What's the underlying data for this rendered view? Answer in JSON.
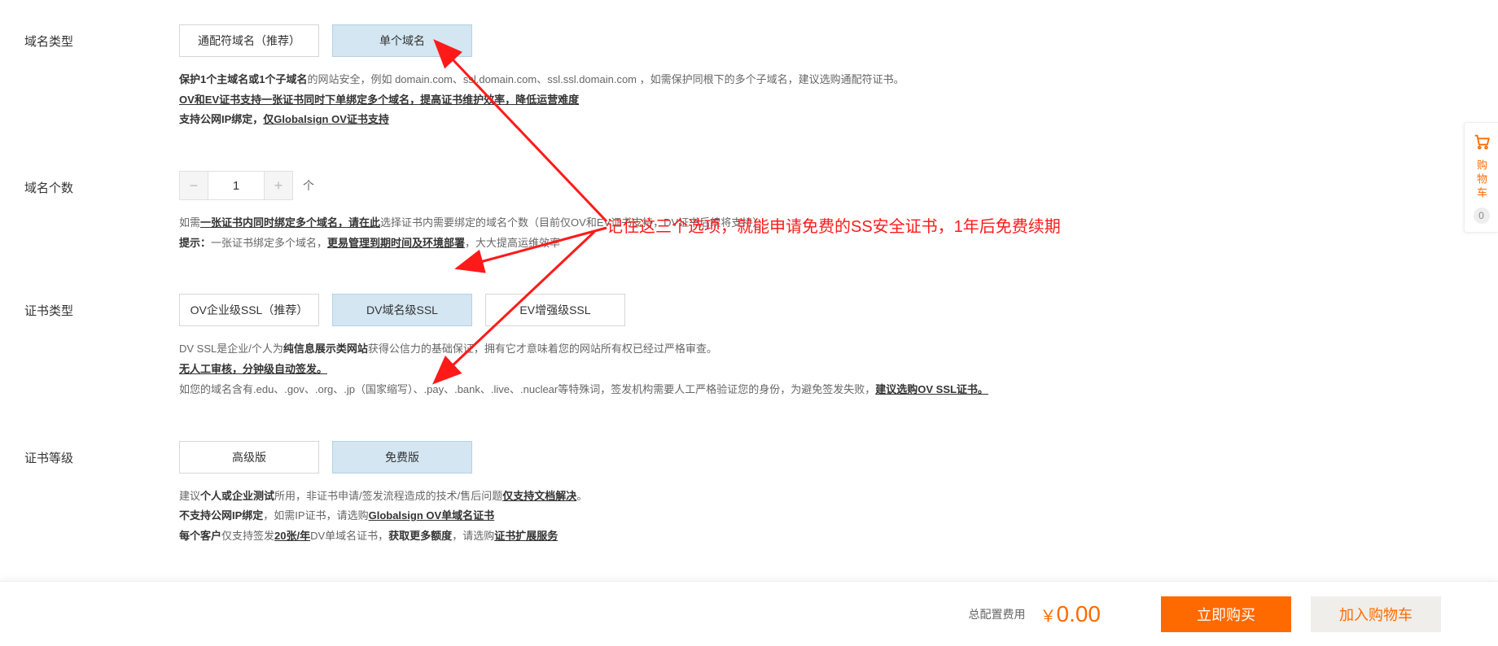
{
  "domainType": {
    "label": "域名类型",
    "opts": [
      "通配符域名（推荐）",
      "单个域名"
    ],
    "description": {
      "line1a": "保护1个主域名或1个子域名",
      "line1b": "的网站安全，例如 domain.com、ssl.domain.com、ssl.ssl.domain.com ，如需保护同根下的多个子域名，建议选购通配符证书。",
      "line2": "OV和EV证书支持一张证书同时下单绑定多个域名，提高证书维护效率，降低运营难度",
      "line3a": "支持公网IP绑定，",
      "line3b": "仅Globalsign OV证书支持"
    }
  },
  "domainCount": {
    "label": "域名个数",
    "value": "1",
    "unit": "个",
    "description": {
      "l1a": "如需",
      "l1b": "一张证书内同时绑定多个域名，请在此",
      "l1c": "选择证书内需要绑定的域名个数（目前仅OV和EV证书支持，DV证书后续将支持）",
      "l2a": "提示：",
      "l2b": "一张证书绑定多个域名，",
      "l2c": "更易管理到期时间及环境部署",
      "l2d": "，大大提高运维效率"
    }
  },
  "certType": {
    "label": "证书类型",
    "opts": [
      "OV企业级SSL（推荐）",
      "DV域名级SSL",
      "EV增强级SSL"
    ],
    "description": {
      "l1a": "DV SSL是企业/个人为",
      "l1b": "纯信息展示类网站",
      "l1c": "获得公信力的基础保证，拥有它才意味着您的网站所有权已经过严格审查。",
      "l2": "无人工审核，分钟级自动签发。",
      "l3a": "如您的域名含有.edu、.gov、.org、.jp（国家缩写）、.pay、.bank、.live、.nuclear等特殊词，签发机构需要人工严格验证您的身份，为避免签发失败，",
      "l3b": "建议选购OV SSL证书。"
    }
  },
  "certLevel": {
    "label": "证书等级",
    "opts": [
      "高级版",
      "免费版"
    ],
    "description": {
      "l1a": "建议",
      "l1b": "个人或企业测试",
      "l1c": "所用，非证书申请/签发流程造成的技术/售后问题",
      "l1d": "仅支持文档解决",
      "l1e": "。",
      "l2a": "不支持公网IP绑定",
      "l2b": "，如需IP证书，请选购",
      "l2c": "Globalsign OV单域名证书",
      "l3a": "每个客户",
      "l3b": "仅支持签发",
      "l3c": "20张/年",
      "l3d": "DV单域名证书，",
      "l3e": "获取更多额度",
      "l3f": "，请选购",
      "l3g": "证书扩展服务"
    }
  },
  "annotation": "记住这三个选项，就能申请免费的SS安全证书，1年后免费续期",
  "footer": {
    "totalLabel": "总配置费用",
    "currency": "￥",
    "price": "0.00",
    "buyNow": "立即购买",
    "addToCart": "加入购物车"
  },
  "cartSidebar": {
    "label": "购物车",
    "count": "0"
  }
}
